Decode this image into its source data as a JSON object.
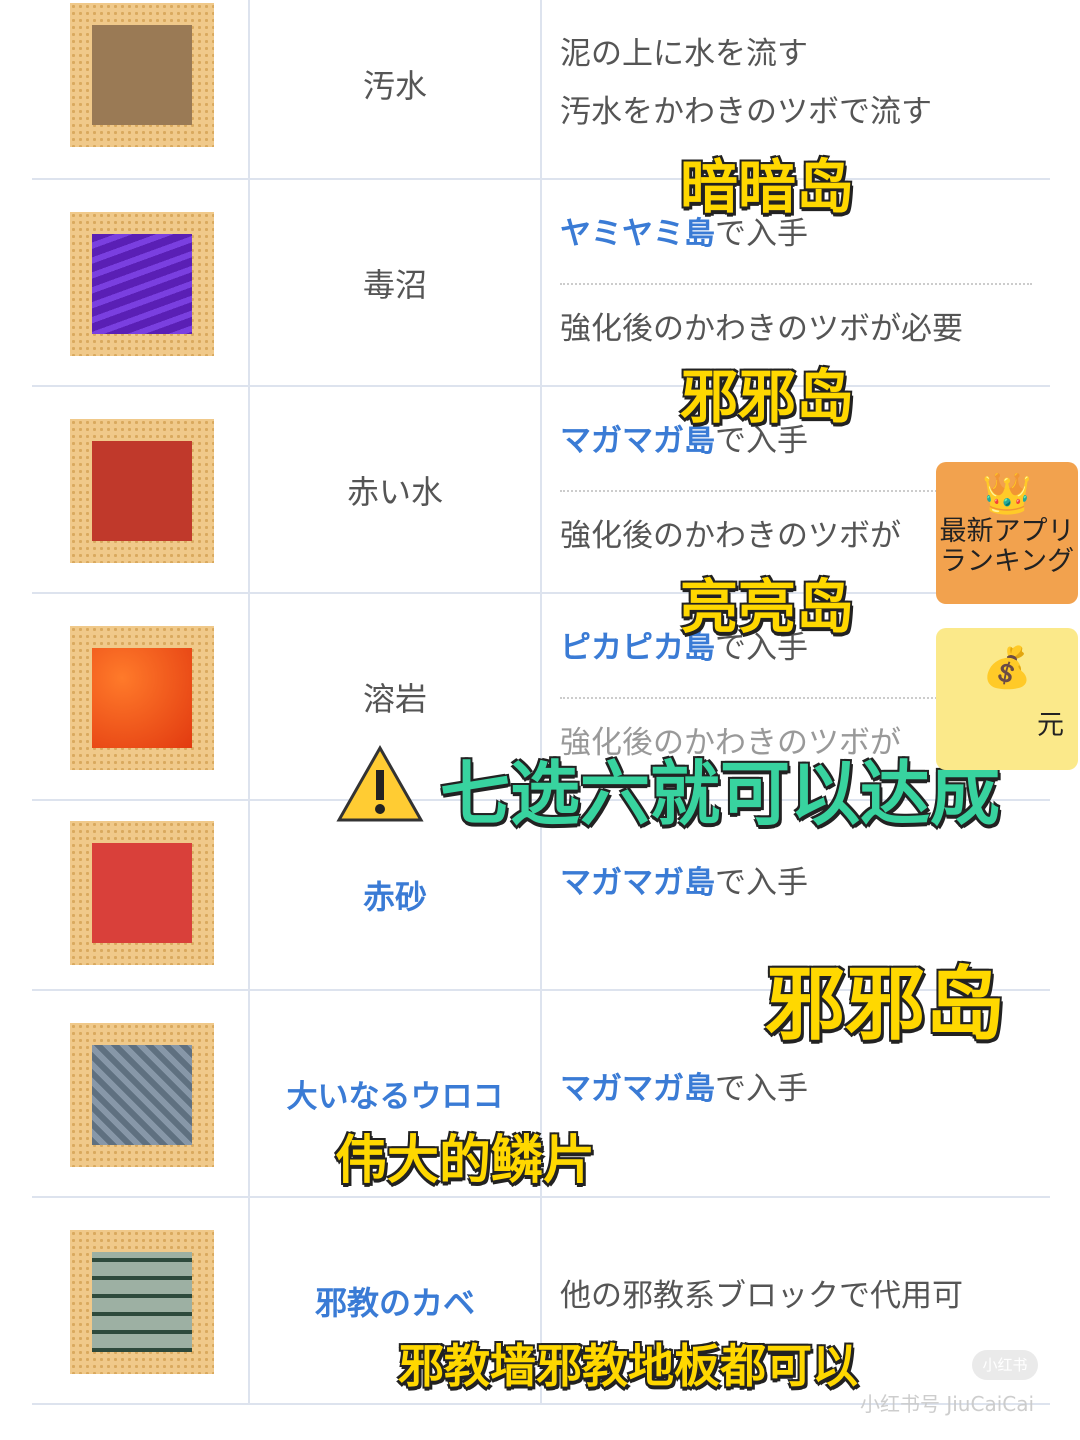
{
  "rows": [
    {
      "name": "汚水",
      "desc_lines": [
        "泥の上に水を流す",
        "汚水をかわきのツボで流す"
      ]
    },
    {
      "name": "毒沼",
      "island": "ヤミヤミ島",
      "suffix": "で入手",
      "extra": "強化後のかわきのツボが必要"
    },
    {
      "name": "赤い水",
      "island": "マガマガ島",
      "suffix": "で入手",
      "extra": "強化後のかわきのツボが"
    },
    {
      "name": "溶岩",
      "island": "ピカピカ島",
      "suffix": "で入手",
      "extra": "強化後のかわきのツボが"
    },
    {
      "name": "赤砂",
      "island": "マガマガ島",
      "suffix": "で入手"
    },
    {
      "name": "大いなるウロコ",
      "island": "マガマガ島",
      "suffix": "で入手"
    },
    {
      "name": "邪教のカベ",
      "desc": "他の邪教系ブロックで代用可"
    }
  ],
  "overlays": {
    "o1": "暗暗岛",
    "o2": "邪邪岛",
    "o3": "亮亮岛",
    "o4": "七选六就可以达成",
    "o5": "邪邪岛",
    "o6": "伟大的鳞片",
    "o7": "邪教墙邪教地板都可以"
  },
  "side": {
    "ranking": "最新アプリ\nランキング",
    "crown_icon": "crown-icon",
    "money_icon": "money-bag-icon",
    "money_text": "元"
  },
  "watermark": {
    "logo": "小红书",
    "id": "小红书号 JiuCaiCai"
  },
  "colors": {
    "link": "#3a7bd5",
    "overlay": "#ffd800",
    "green": "#38d39f"
  }
}
